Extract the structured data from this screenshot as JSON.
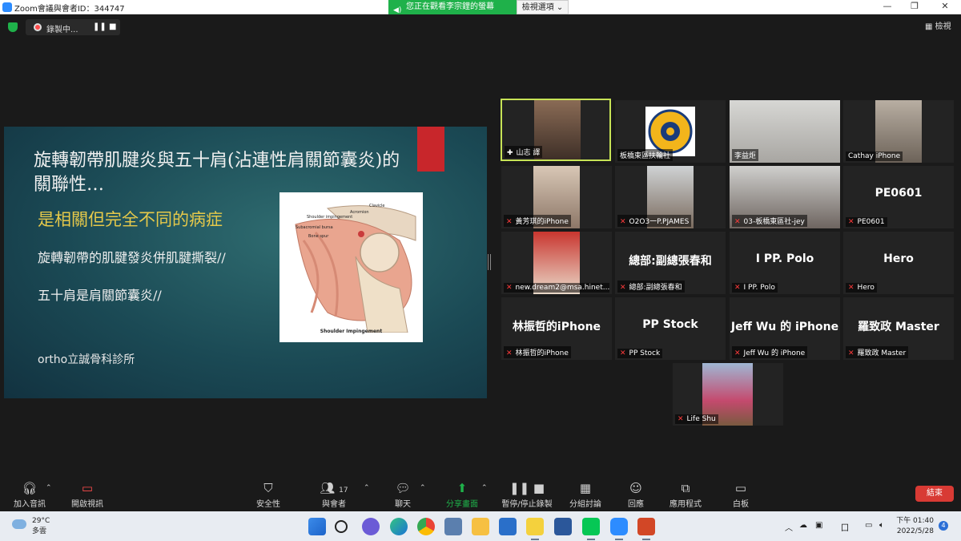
{
  "window": {
    "title": "Zoom會議與會者ID：344747",
    "share_banner": "您正在觀看李宗鋰的螢幕",
    "view_options": "檢視選項 ⌄",
    "minimize": "—",
    "maximize": "❐",
    "close": "✕"
  },
  "recording": {
    "label": "錄製中...",
    "pause": "❚❚",
    "stop": "■",
    "view_label": "▦ 檢視"
  },
  "slide": {
    "title": "旋轉韌帶肌腱炎與五十肩(沾連性肩關節囊炎)的關聯性…",
    "subtitle": "是相關但完全不同的病症",
    "line1": "旋轉韌帶的肌腱發炎併肌腱撕裂//",
    "line2": "五十肩是肩關節囊炎//",
    "footer": "ortho立誠骨科診所",
    "illustration": {
      "caption": "Shoulder Impingement",
      "labels": [
        "Clavicle",
        "Acromion",
        "Shoulder impingement",
        "Subacromial bursa",
        "Bone spur"
      ]
    }
  },
  "gallery": [
    {
      "name": "山志 譯",
      "type": "video",
      "muted": false,
      "active": true
    },
    {
      "name": "板橋東區扶輪社",
      "type": "logo",
      "muted": false
    },
    {
      "name": "李益炬",
      "type": "video",
      "muted": false
    },
    {
      "name": "Cathay iPhone",
      "type": "video",
      "muted": false
    },
    {
      "name": "黃芳琪的iPhone",
      "type": "video",
      "muted": true
    },
    {
      "name": "O2O3一P.PJAMES",
      "type": "video",
      "muted": true
    },
    {
      "name": "03-板橋東區社-jey",
      "type": "video",
      "muted": true
    },
    {
      "name": "PE0601",
      "big": "PE0601",
      "type": "text",
      "muted": true
    },
    {
      "name": "new.dream2@msa.hinet....",
      "type": "video",
      "muted": true
    },
    {
      "name": "總部:副總張春和",
      "big": "總部:副總張春和",
      "type": "text",
      "muted": true
    },
    {
      "name": "I PP. Polo",
      "big": "I PP. Polo",
      "type": "text",
      "muted": true
    },
    {
      "name": "Hero",
      "big": "Hero",
      "type": "text",
      "muted": true
    },
    {
      "name": "林振哲的iPhone",
      "big": "林振哲的iPhone",
      "type": "text",
      "muted": true
    },
    {
      "name": "PP Stock",
      "big": "PP Stock",
      "type": "text",
      "muted": true
    },
    {
      "name": "Jeff Wu 的 iPhone",
      "big": "Jeff Wu 的 iPhone",
      "type": "text",
      "muted": true
    },
    {
      "name": "羅致政 Master",
      "big": "羅致政 Master",
      "type": "text",
      "muted": true
    },
    {
      "name": "Life Shu",
      "type": "video",
      "muted": true
    }
  ],
  "toolbar": {
    "join_audio": "加入音訊",
    "start_video": "開啟視訊",
    "security": "安全性",
    "participants": "與會者",
    "participants_count": "17",
    "chat": "聊天",
    "share_screen": "分享畫面",
    "pause_record": "暫停/停止錄製",
    "breakout": "分組討論",
    "reactions": "回應",
    "apps": "應用程式",
    "whiteboard": "白板",
    "end": "結束"
  },
  "taskbar": {
    "temp": "29°C",
    "weather": "多雲",
    "time": "下午 01:40",
    "date": "2022/5/28",
    "notifications": "4"
  },
  "colors": {
    "share_green": "#1fb14a",
    "slide_yellow": "#e6c94a",
    "active_border": "#c7e356",
    "end_red": "#d83a34"
  }
}
